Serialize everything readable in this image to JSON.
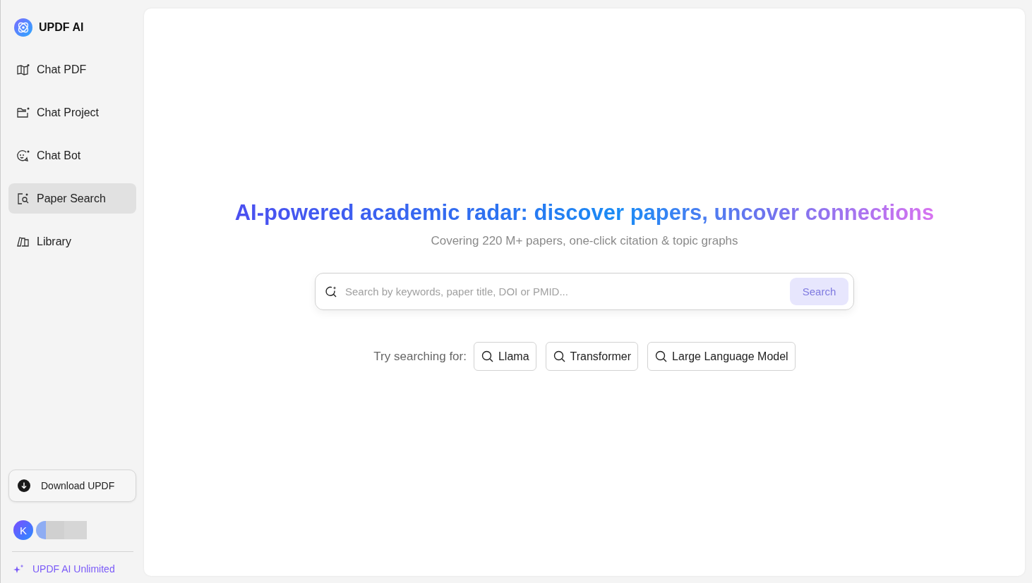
{
  "brand": {
    "name": "UPDF AI"
  },
  "nav": [
    {
      "label": "Chat PDF",
      "selected": false
    },
    {
      "label": "Chat Project",
      "selected": false
    },
    {
      "label": "Chat Bot",
      "selected": false
    },
    {
      "label": "Paper Search",
      "selected": true
    },
    {
      "label": "Library",
      "selected": false
    }
  ],
  "download_button": "Download UPDF",
  "user": {
    "initial": "K"
  },
  "upgrade_link": "UPDF AI Unlimited",
  "hero": {
    "title": "AI-powered academic radar: discover papers, uncover connections",
    "subtitle": "Covering 220 M+ papers, one-click citation & topic graphs"
  },
  "search": {
    "placeholder": "Search by keywords, paper title, DOI or PMID...",
    "button": "Search",
    "disabled": true
  },
  "suggestions": {
    "label": "Try searching for:",
    "items": [
      "Llama",
      "Transformer",
      "Large Language Model"
    ]
  }
}
